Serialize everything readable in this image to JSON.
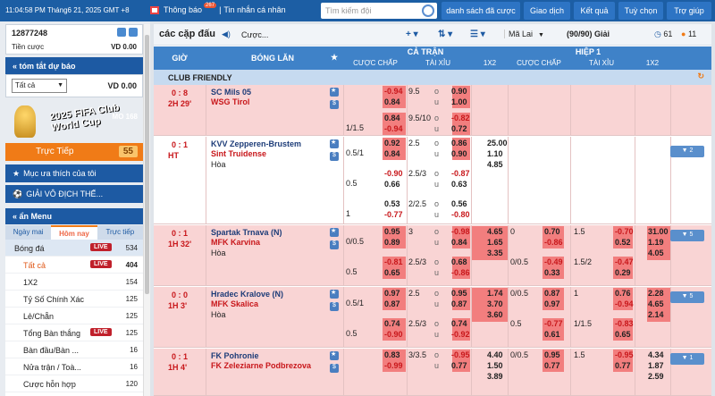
{
  "topbar": {
    "time": "11:04:58 PM Tháng6 21, 2025 GMT +8",
    "notifications": "Thông báo",
    "notif_count": "267",
    "sep": "|",
    "messages": "Tin nhắn cá nhân",
    "search_placeholder": "Tìm kiếm đội",
    "buttons": [
      "danh sách đã cược",
      "Giao dịch",
      "Kết quả",
      "Tuỳ chọn",
      "Trợ giúp"
    ]
  },
  "account": {
    "id": "12877248",
    "balance_label": "Tiền cược",
    "balance_value": "VD 0.00"
  },
  "summary": {
    "title": "tóm tắt dự báo",
    "select": "Tất cả",
    "value": "VD 0.00"
  },
  "banner": {
    "text": "2025 FIFA Club World Cup",
    "logo": "MO 168"
  },
  "live": {
    "label": "Trực Tiếp",
    "count": "55"
  },
  "favorites": "Mục ưa thích của tôi",
  "championship": "GIẢI VÔ ĐỊCH THẾ...",
  "menu": {
    "title": "ẩn Menu",
    "tabs": [
      "Ngày mai",
      "Hôm nay",
      "Trực tiếp"
    ],
    "items": [
      {
        "label": "Bóng đá",
        "live": "LIVE",
        "count": "534"
      },
      {
        "label": "Tất cả",
        "live": "LIVE",
        "count": "404"
      },
      {
        "label": "1X2",
        "count": "154"
      },
      {
        "label": "Tỷ Số Chính Xác",
        "count": "125"
      },
      {
        "label": "Lẻ/Chẵn",
        "count": "125"
      },
      {
        "label": "Tổng Bàn thắng",
        "live": "LIVE",
        "count": "125"
      },
      {
        "label": "Bàn đầu/Bàn ...",
        "count": "16"
      },
      {
        "label": "Nửa trận / Toà...",
        "count": "16"
      },
      {
        "label": "Cược hỗn hợp",
        "count": "120"
      }
    ]
  },
  "main": {
    "title": "các cặp đấu",
    "filter": "Cược...",
    "league_select": "Mã Lai",
    "count": "(90/90) Giải",
    "c1": "61",
    "c2": "11"
  },
  "headers": {
    "time": "GIỜ",
    "match": "BÓNG LĂN",
    "full": "CẢ TRẬN",
    "half": "HIỆP 1",
    "hdp": "CƯỢC CHẤP",
    "ou": "TÀI XỈU",
    "x12": "1X2",
    "hdp2": "CƯỢC CHẤP",
    "ou2": "TÀI XỈU",
    "x122": "1X2"
  },
  "league": "CLUB FRIENDLY",
  "matches": [
    {
      "score": "0 : 8",
      "time": "2H 29'",
      "home": "SC Mils 05",
      "away": "WSG Tirol",
      "draw": "",
      "lines": [
        {
          "h": "",
          "hh": "-0.94",
          "ha": "0.84",
          "o": "9.5",
          "ov": "o",
          "oh": "0.90",
          "oa": "1.00"
        },
        {
          "h": "1/1.5",
          "hh": "0.84",
          "ha": "-0.94",
          "o": "9.5/10",
          "ov": "o",
          "oh": "-0.82",
          "oa": "0.72"
        }
      ]
    },
    {
      "score": "0 : 1",
      "time": "HT",
      "home": "KVV Zepperen-Brustem",
      "away": "Sint Truidense",
      "draw": "Hòa",
      "more": "▼ 2",
      "x12": [
        "25.00",
        "1.10",
        "4.85"
      ],
      "lines": [
        {
          "h": "0.5/1",
          "hh": "0.92",
          "ha": "0.84",
          "o": "2.5",
          "ov": "o",
          "oh": "0.86",
          "oa": "0.90"
        },
        {
          "h": "0.5",
          "hh": "-0.90",
          "ha": "0.66",
          "o": "2.5/3",
          "ov": "o",
          "oh": "-0.87",
          "oa": "0.63"
        },
        {
          "h": "1",
          "hh": "0.53",
          "ha": "-0.77",
          "o": "2/2.5",
          "ov": "o",
          "oh": "0.56",
          "oa": "-0.80"
        }
      ]
    },
    {
      "score": "0 : 1",
      "time": "1H 32'",
      "home": "Spartak Trnava (N)",
      "away": "MFK Karvina",
      "draw": "Hòa",
      "more": "▼ 5",
      "x12": [
        "4.65",
        "1.65",
        "3.35"
      ],
      "half_x12": [
        "31.00",
        "1.19",
        "4.05"
      ],
      "lines": [
        {
          "h": "0/0.5",
          "hh": "0.95",
          "ha": "0.89",
          "o": "3",
          "ov": "o",
          "oh": "-0.98",
          "oa": "0.84",
          "h2": "0",
          "h2h": "0.70",
          "h2a": "-0.86",
          "o2": "1.5",
          "o2h": "-0.70",
          "o2a": "0.52"
        },
        {
          "h": "0.5",
          "hh": "-0.81",
          "ha": "0.65",
          "o": "2.5/3",
          "ov": "o",
          "oh": "0.68",
          "oa": "-0.86",
          "h2": "0/0.5",
          "h2h": "-0.49",
          "h2a": "0.33",
          "o2": "1.5/2",
          "o2h": "-0.47",
          "o2a": "0.29"
        }
      ]
    },
    {
      "score": "0 : 0",
      "time": "1H 3'",
      "home": "Hradec Kralove (N)",
      "away": "MFK Skalica",
      "draw": "Hòa",
      "more": "▼ 5",
      "x12": [
        "1.74",
        "3.70",
        "3.60"
      ],
      "half_x12": [
        "2.28",
        "4.65",
        "2.14"
      ],
      "lines": [
        {
          "h": "0.5/1",
          "hh": "0.97",
          "ha": "0.87",
          "o": "2.5",
          "ov": "o",
          "oh": "0.95",
          "oa": "0.87",
          "h2": "0/0.5",
          "h2h": "0.87",
          "h2a": "0.97",
          "o2": "1",
          "o2h": "0.76",
          "o2a": "-0.94"
        },
        {
          "h": "0.5",
          "hh": "0.74",
          "ha": "-0.90",
          "o": "2.5/3",
          "ov": "o",
          "oh": "0.74",
          "oa": "-0.92",
          "h2": "0.5",
          "h2h": "-0.77",
          "h2a": "0.61",
          "o2": "1/1.5",
          "o2h": "-0.83",
          "o2a": "0.65"
        }
      ]
    },
    {
      "score": "0 : 1",
      "time": "1H 4'",
      "home": "FK Pohronie",
      "away": "FK Zeleziarne Podbrezova",
      "draw": "",
      "more": "▼ 1",
      "x12": [
        "4.40",
        "1.50",
        "3.89"
      ],
      "half_x12": [
        "4.34",
        "1.87",
        "2.59"
      ],
      "lines": [
        {
          "h": "",
          "hh": "0.83",
          "ha": "-0.99",
          "o": "3/3.5",
          "ov": "o",
          "oh": "-0.95",
          "oa": "0.77",
          "h2": "0/0.5",
          "h2h": "0.95",
          "h2a": "0.77",
          "o2": "1.5",
          "o2h": "-0.95",
          "o2a": "0.77"
        }
      ]
    }
  ]
}
